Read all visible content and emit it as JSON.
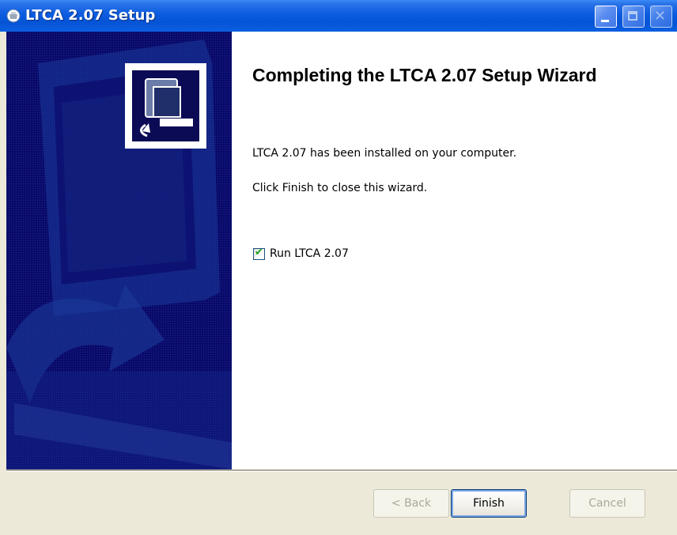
{
  "window": {
    "title": "LTCA 2.07 Setup",
    "icon": "setup-shield-icon"
  },
  "caption_buttons": {
    "minimize": "minimize-icon",
    "maximize": "maximize-icon",
    "close": "close-icon"
  },
  "wizard": {
    "heading": "Completing the LTCA 2.07 Setup Wizard",
    "message_installed": "LTCA 2.07 has been installed on your computer.",
    "message_finish": "Click Finish to close this wizard.",
    "run_checkbox": {
      "label": "Run LTCA 2.07",
      "checked": true
    }
  },
  "buttons": {
    "back": "< Back",
    "finish": "Finish",
    "cancel": "Cancel"
  },
  "colors": {
    "titlebar": "#0654d6",
    "side_panel": "#0a0a6a",
    "dialog_background": "#ece9d8"
  }
}
